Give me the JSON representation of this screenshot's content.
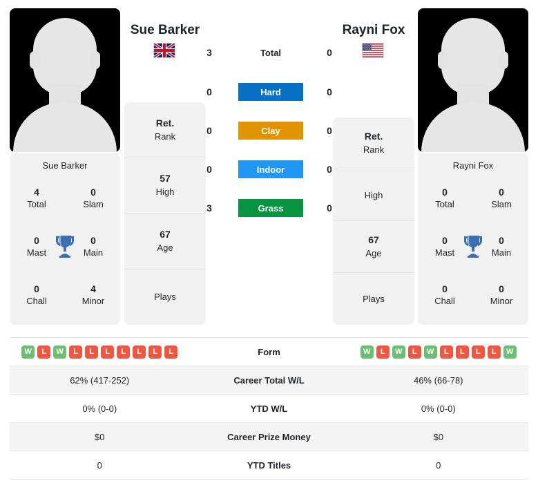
{
  "players": {
    "left": {
      "name": "Sue Barker",
      "flag": "gb-flag-icon",
      "panel_name": "Sue Barker",
      "titles": {
        "total_val": "4",
        "total_lbl": "Total",
        "slam_val": "0",
        "slam_lbl": "Slam",
        "mast_val": "0",
        "mast_lbl": "Mast",
        "main_val": "0",
        "main_lbl": "Main",
        "chall_val": "0",
        "chall_lbl": "Chall",
        "minor_val": "4",
        "minor_lbl": "Minor"
      },
      "rank_cells": [
        {
          "value": "Ret.",
          "label": "Rank"
        },
        {
          "value": "57",
          "label": "High"
        },
        {
          "value": "67",
          "label": "Age"
        },
        {
          "value": "",
          "label": "Plays"
        }
      ]
    },
    "right": {
      "name": "Rayni Fox",
      "flag": "us-flag-icon",
      "panel_name": "Rayni Fox",
      "titles": {
        "total_val": "0",
        "total_lbl": "Total",
        "slam_val": "0",
        "slam_lbl": "Slam",
        "mast_val": "0",
        "mast_lbl": "Mast",
        "main_val": "0",
        "main_lbl": "Main",
        "chall_val": "0",
        "chall_lbl": "Chall",
        "minor_val": "0",
        "minor_lbl": "Minor"
      },
      "rank_cells": [
        {
          "value": "Ret.",
          "label": "Rank"
        },
        {
          "value": "",
          "label": "High"
        },
        {
          "value": "67",
          "label": "Age"
        },
        {
          "value": "",
          "label": "Plays"
        }
      ]
    }
  },
  "surfaces": [
    {
      "label": "Total",
      "left": "3",
      "right": "0",
      "color": "transparent",
      "text_color": "#212529"
    },
    {
      "label": "Hard",
      "left": "0",
      "right": "0",
      "color": "#0770c4",
      "text_color": "#ffffff"
    },
    {
      "label": "Clay",
      "left": "0",
      "right": "0",
      "color": "#e29400",
      "text_color": "#ffffff"
    },
    {
      "label": "Indoor",
      "left": "0",
      "right": "0",
      "color": "#2196f3",
      "text_color": "#ffffff"
    },
    {
      "label": "Grass",
      "left": "3",
      "right": "0",
      "color": "#069440",
      "text_color": "#ffffff"
    }
  ],
  "table": {
    "form_label": "Form",
    "form_left": [
      "W",
      "L",
      "W",
      "L",
      "L",
      "L",
      "L",
      "L",
      "L",
      "L"
    ],
    "form_right": [
      "W",
      "L",
      "W",
      "L",
      "W",
      "L",
      "L",
      "L",
      "L",
      "W"
    ],
    "rows": [
      {
        "label": "Career Total W/L",
        "left": "62% (417-252)",
        "right": "46% (66-78)"
      },
      {
        "label": "YTD W/L",
        "left": "0% (0-0)",
        "right": "0% (0-0)"
      },
      {
        "label": "Career Prize Money",
        "left": "$0",
        "right": "$0"
      },
      {
        "label": "YTD Titles",
        "left": "0",
        "right": "0"
      }
    ]
  },
  "colors": {
    "win": "#6cbf72",
    "loss": "#ee5843",
    "panel_bg": "#f1f1f1",
    "trophy": "#3d6eb0"
  }
}
